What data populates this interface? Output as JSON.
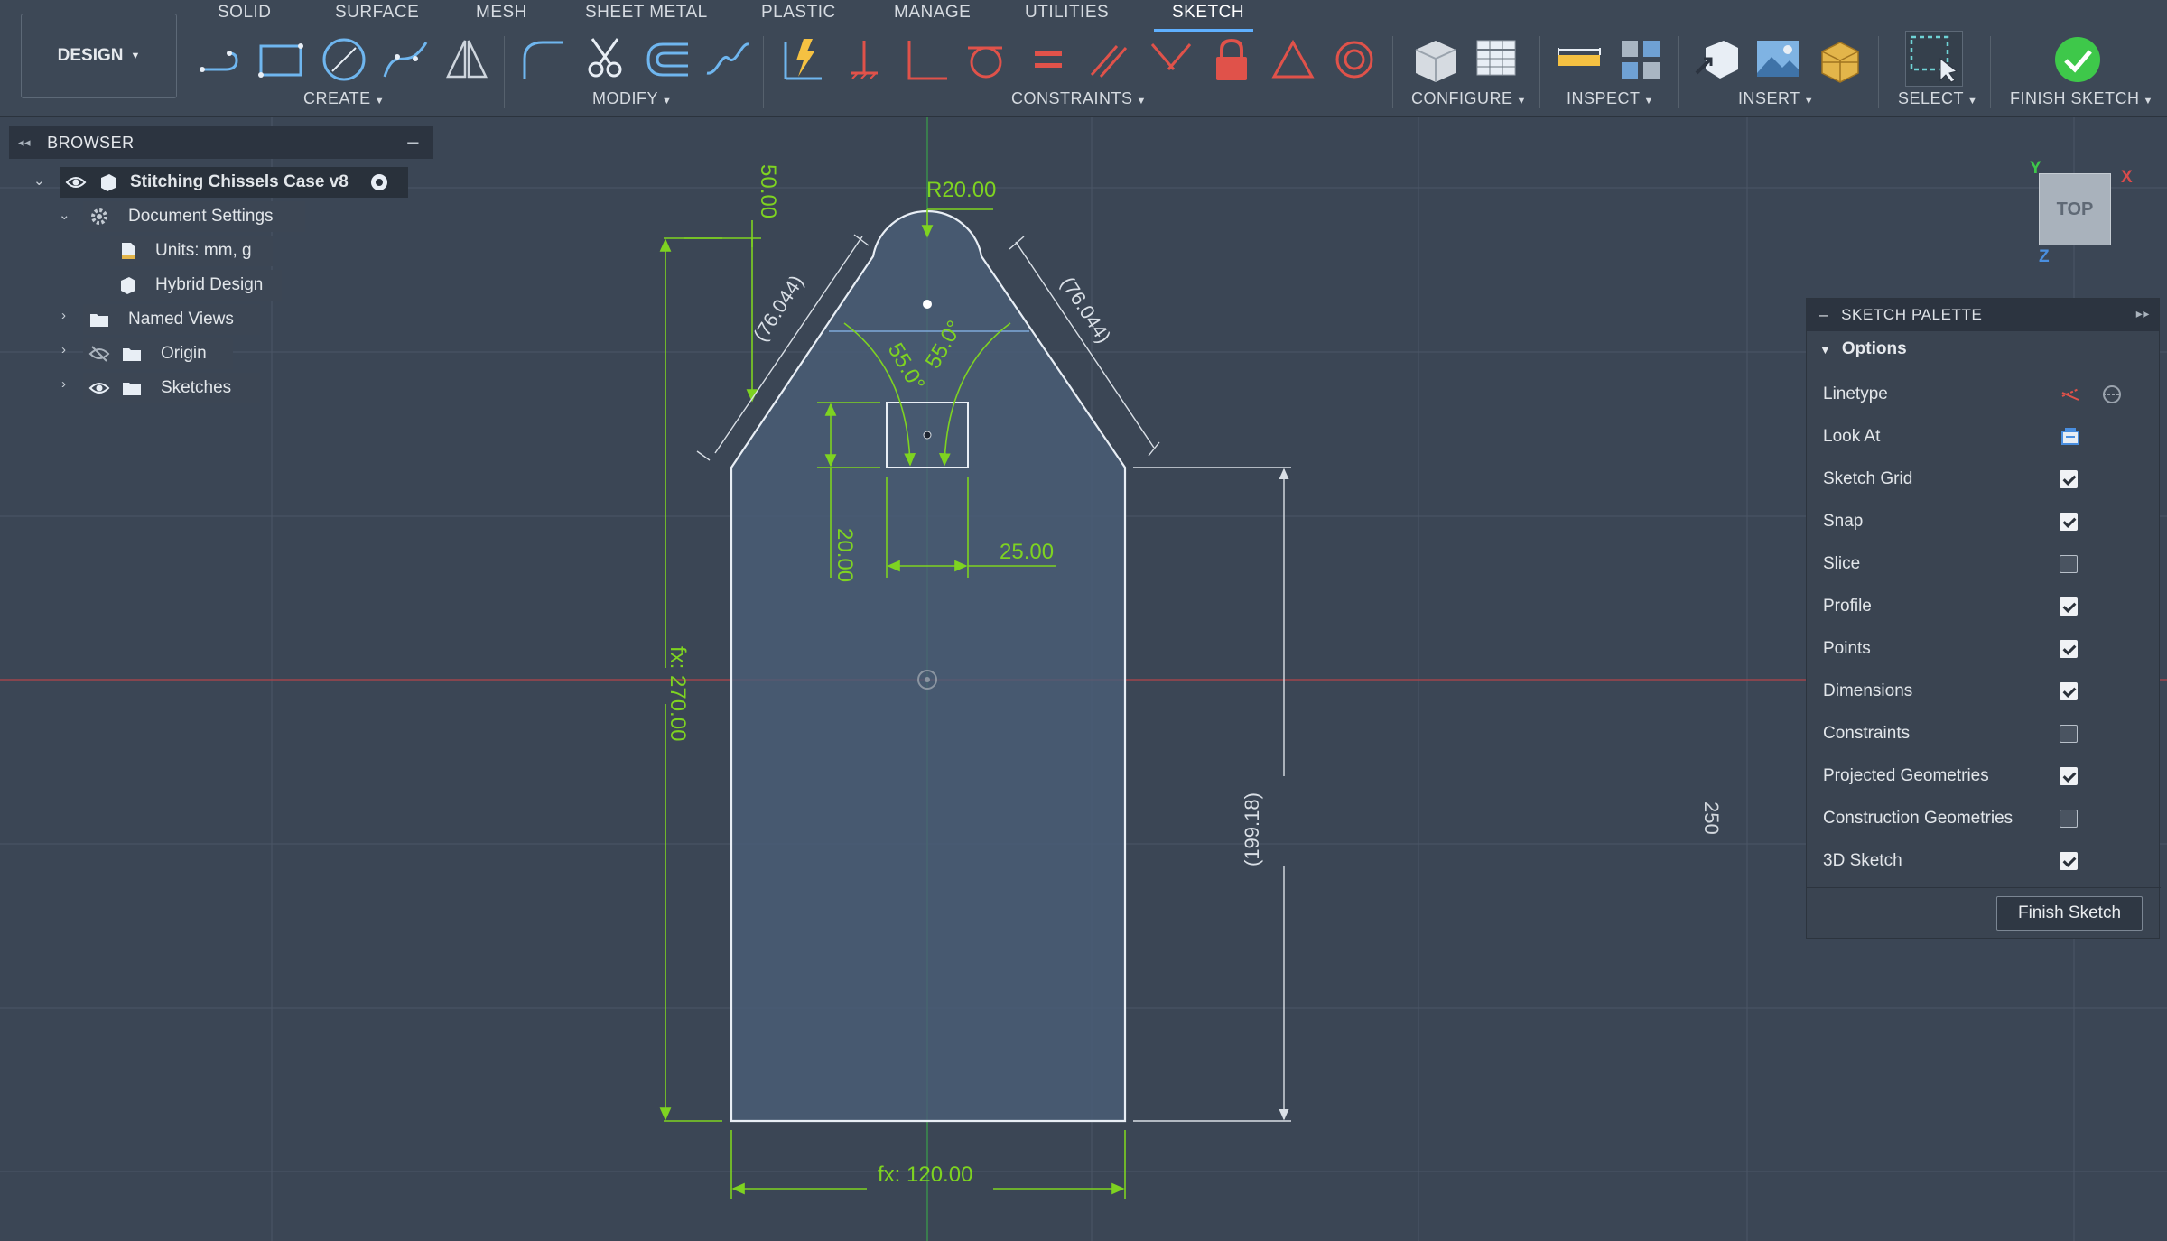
{
  "toolbar": {
    "workspace_label": "DESIGN",
    "tabs": [
      "SOLID",
      "SURFACE",
      "MESH",
      "SHEET METAL",
      "PLASTIC",
      "MANAGE",
      "UTILITIES",
      "SKETCH"
    ],
    "active_tab": "SKETCH",
    "groups": [
      "CREATE",
      "MODIFY",
      "CONSTRAINTS",
      "CONFIGURE",
      "INSPECT",
      "INSERT",
      "SELECT",
      "FINISH SKETCH"
    ]
  },
  "browser": {
    "title": "BROWSER",
    "items": [
      {
        "label": "Stitching Chissels Case v8",
        "icon": "component-icon"
      },
      {
        "label": "Document Settings",
        "icon": "gear-icon"
      },
      {
        "label": "Units: mm, g",
        "icon": "document-icon"
      },
      {
        "label": "Hybrid Design",
        "icon": "cube-icon"
      },
      {
        "label": "Named Views",
        "icon": "folder-icon"
      },
      {
        "label": "Origin",
        "icon": "folder-icon"
      },
      {
        "label": "Sketches",
        "icon": "folder-icon"
      }
    ]
  },
  "palette": {
    "title": "SKETCH PALETTE",
    "section": "Options",
    "rows": [
      {
        "label": "Linetype",
        "type": "icons"
      },
      {
        "label": "Look At",
        "type": "icon"
      },
      {
        "label": "Sketch Grid",
        "checked": true
      },
      {
        "label": "Snap",
        "checked": true
      },
      {
        "label": "Slice",
        "checked": false
      },
      {
        "label": "Profile",
        "checked": true
      },
      {
        "label": "Points",
        "checked": true
      },
      {
        "label": "Dimensions",
        "checked": true
      },
      {
        "label": "Constraints",
        "checked": false
      },
      {
        "label": "Projected Geometries",
        "checked": true
      },
      {
        "label": "Construction Geometries",
        "checked": false
      },
      {
        "label": "3D Sketch",
        "checked": true
      }
    ],
    "finish_button": "Finish Sketch"
  },
  "viewcube": {
    "face": "TOP",
    "x": "X",
    "y": "Y",
    "z": "Z"
  },
  "sketch": {
    "dimensions": {
      "radius": "R20.00",
      "tip_height": "50.00",
      "left_slant": "(76.044)",
      "right_slant": "(76.044)",
      "angle_left": "55.0°",
      "angle_right": "55.0°",
      "slot_offset": "20.00",
      "slot_width": "25.00",
      "total_height": "fx: 270.00",
      "side_height": "(199.18)",
      "base_width": "fx: 120.00"
    },
    "side_label": "250"
  },
  "colors": {
    "background": "#3b4655",
    "dimension": "#7ed321",
    "profile": "#e8eef5",
    "axis_red": "#c0454a",
    "axis_green": "#4caf50"
  }
}
